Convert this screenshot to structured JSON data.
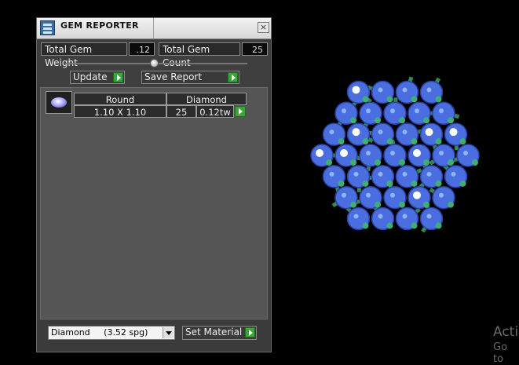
{
  "window": {
    "title": "GEM REPORTER",
    "close_label": "×"
  },
  "summary": {
    "weight_label": "Total Gem Weight",
    "weight_value": ".12",
    "count_label": "Total Gem Count",
    "count_value": "25"
  },
  "toolbar": {
    "update_label": "Update",
    "save_report_label": "Save Report"
  },
  "gem_table": {
    "header": {
      "shape": "Round",
      "material": "Diamond"
    },
    "rows": [
      {
        "size": "1.10 X 1.10",
        "count": "25",
        "weight": "0.12tw"
      }
    ]
  },
  "footer": {
    "material_select_value": "Diamond     (3.52 spg)",
    "set_material_label": "Set Material"
  },
  "overlay": {
    "activate_line1": "Acti",
    "activate_line2": "Go to"
  },
  "colors": {
    "panel_bg": "#3f3f3f",
    "accent_green": "#3aa53a",
    "gem_blue": "#4a6ee0",
    "prong_green": "#2e8b57"
  },
  "icons": [
    "app-icon",
    "close-icon",
    "play-arrow-icon",
    "gem-thumbnail",
    "dropdown-arrow-icon"
  ]
}
